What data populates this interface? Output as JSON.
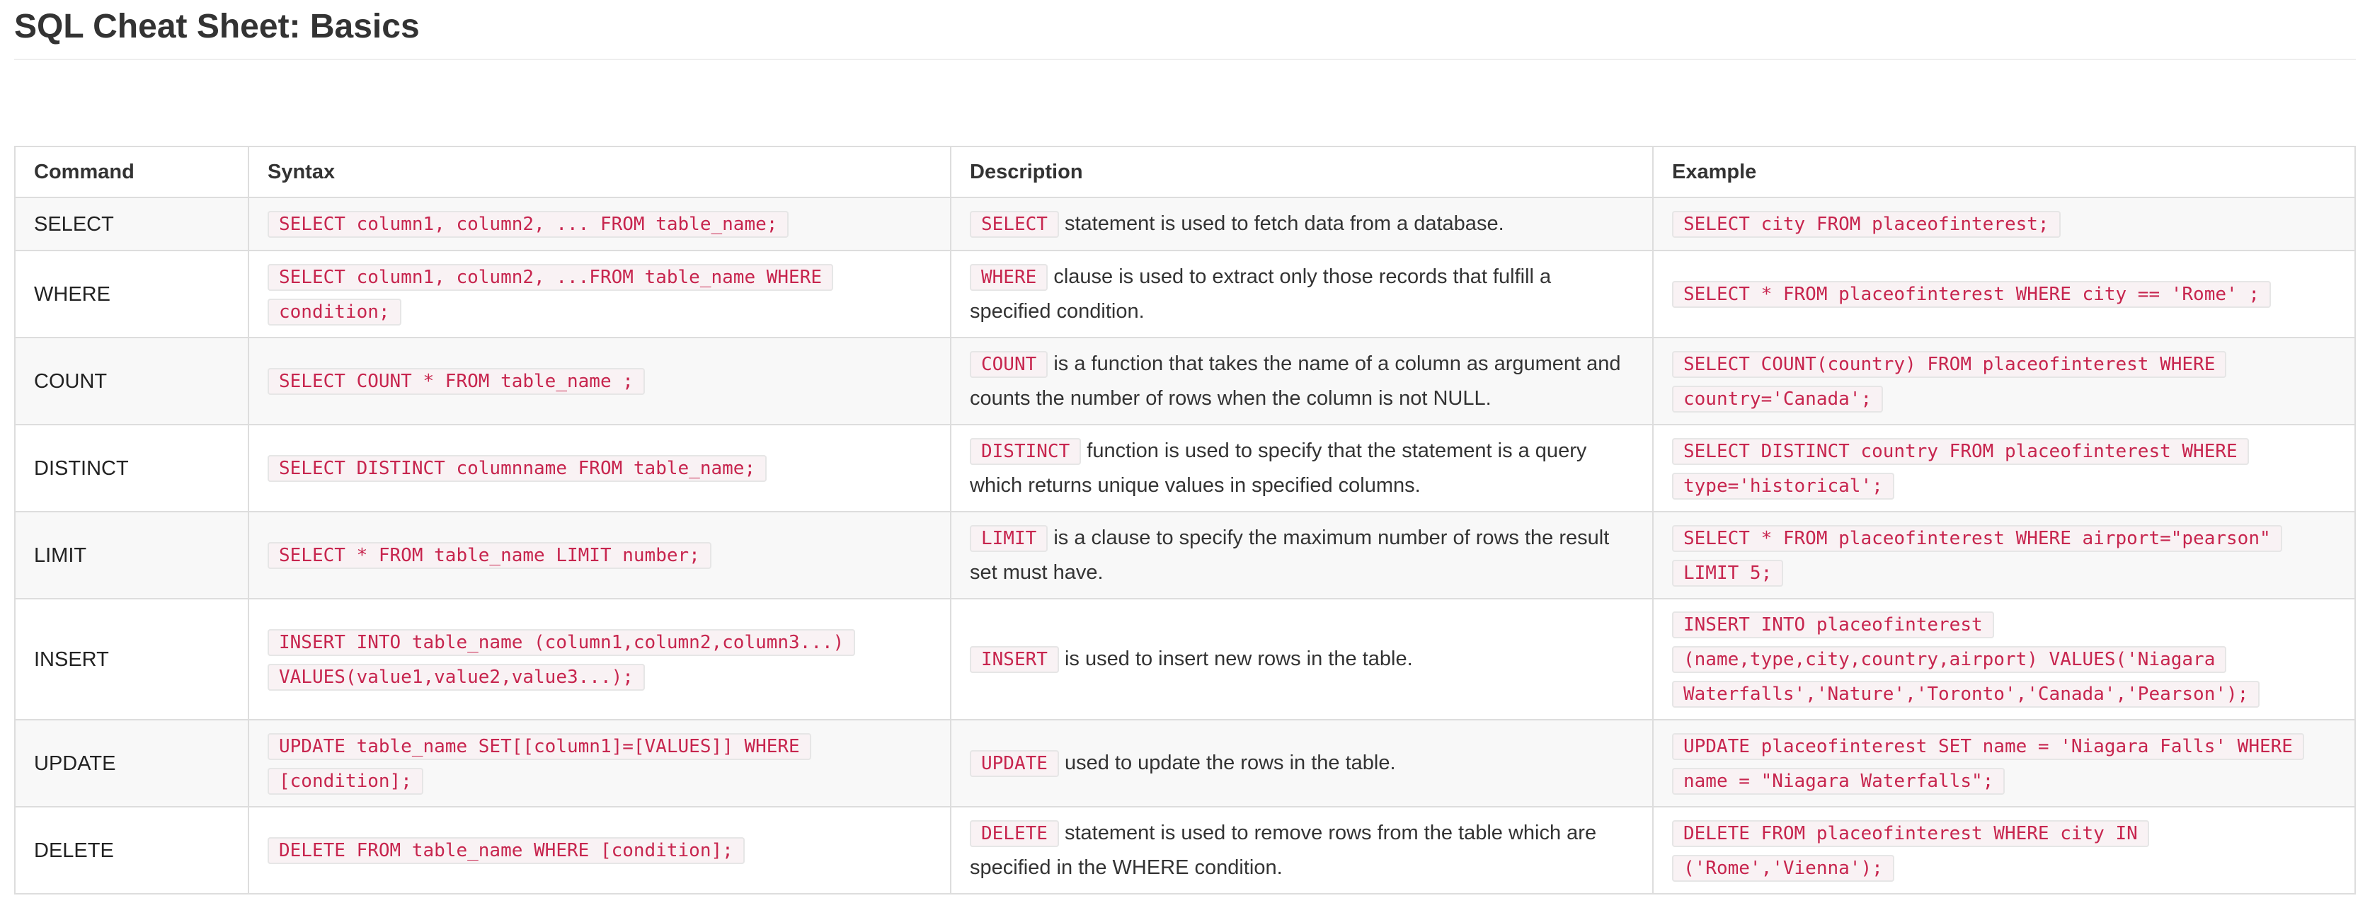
{
  "title": "SQL Cheat Sheet: Basics",
  "headers": {
    "command": "Command",
    "syntax": "Syntax",
    "description": "Description",
    "example": "Example"
  },
  "rows": [
    {
      "command": "SELECT",
      "syntax": "SELECT column1, column2, ... FROM table_name;",
      "desc_code": "SELECT",
      "desc_text": "statement is used to fetch data from a database.",
      "example": "SELECT city FROM placeofinterest;"
    },
    {
      "command": "WHERE",
      "syntax": "SELECT column1, column2, ...FROM table_name WHERE condition;",
      "desc_code": "WHERE",
      "desc_text": "clause is used to extract only those records that fulfill a specified condition.",
      "example": "SELECT * FROM placeofinterest WHERE city == 'Rome' ;"
    },
    {
      "command": "COUNT",
      "syntax": "SELECT COUNT * FROM table_name ;",
      "desc_code": "COUNT",
      "desc_text": "is a function that takes the name of a column as argument and counts the number of rows when the column is not NULL.",
      "example": "SELECT COUNT(country) FROM placeofinterest WHERE country='Canada';"
    },
    {
      "command": "DISTINCT",
      "syntax": "SELECT DISTINCT columnname FROM table_name;",
      "desc_code": "DISTINCT",
      "desc_text": "function is used to specify that the statement is a query which returns unique values in specified columns.",
      "example": "SELECT DISTINCT country FROM placeofinterest WHERE type='historical';"
    },
    {
      "command": "LIMIT",
      "syntax": "SELECT * FROM table_name LIMIT number;",
      "desc_code": "LIMIT",
      "desc_text": "is a clause to specify the maximum number of rows the result set must have.",
      "example": "SELECT * FROM placeofinterest WHERE airport=\"pearson\" LIMIT 5;"
    },
    {
      "command": "INSERT",
      "syntax": "INSERT INTO table_name (column1,column2,column3...) VALUES(value1,value2,value3...);",
      "desc_code": "INSERT",
      "desc_text": "is used to insert new rows in the table.",
      "example": "INSERT INTO placeofinterest (name,type,city,country,airport) VALUES('Niagara Waterfalls','Nature','Toronto','Canada','Pearson');"
    },
    {
      "command": "UPDATE",
      "syntax": "UPDATE table_name SET[[column1]=[VALUES]] WHERE [condition];",
      "desc_code": "UPDATE",
      "desc_text": "used to update the rows in the table.",
      "example": "UPDATE placeofinterest SET name = 'Niagara Falls' WHERE name = \"Niagara Waterfalls\";"
    },
    {
      "command": "DELETE",
      "syntax": "DELETE FROM table_name WHERE [condition];",
      "desc_code": "DELETE",
      "desc_text": "statement is used to remove rows from the table which are specified in the WHERE condition.",
      "example": "DELETE FROM placeofinterest WHERE city IN ('Rome','Vienna');"
    }
  ]
}
